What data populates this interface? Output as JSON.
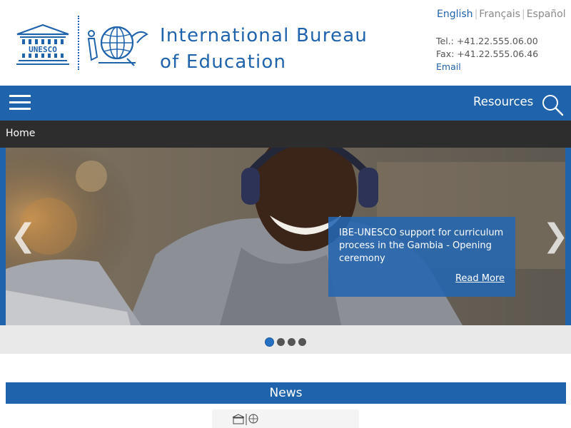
{
  "header": {
    "org_name_line1": "International Bureau",
    "org_name_line2": "of Education",
    "unesco_logo_text": "UNESCO",
    "languages": [
      {
        "label": "English",
        "active": true
      },
      {
        "label": "Français",
        "active": false
      },
      {
        "label": "Español",
        "active": false
      }
    ],
    "contact": {
      "tel": "Tel.: +41.22.555.06.00",
      "fax": "Fax: +41.22.555.06.46",
      "email": "Email"
    }
  },
  "navbar": {
    "resources_label": "Resources",
    "menu_icon": "hamburger-icon",
    "search_icon": "search-icon"
  },
  "breadcrumb": {
    "home": "Home"
  },
  "slider": {
    "caption": "IBE-UNESCO support for curriculum process in the Gambia - Opening ceremony",
    "read_more": "Read More",
    "prev_icon": "chevron-left-icon",
    "next_icon": "chevron-right-icon",
    "prev_glyph": "❮",
    "next_glyph": "❯",
    "slide_count": 4,
    "active_slide": 1
  },
  "news": {
    "title": "News"
  },
  "colors": {
    "brand_blue": "#1f63ad",
    "breadcrumb_bg": "#2d2d2d",
    "slider_bg": "#e9e9e9"
  }
}
